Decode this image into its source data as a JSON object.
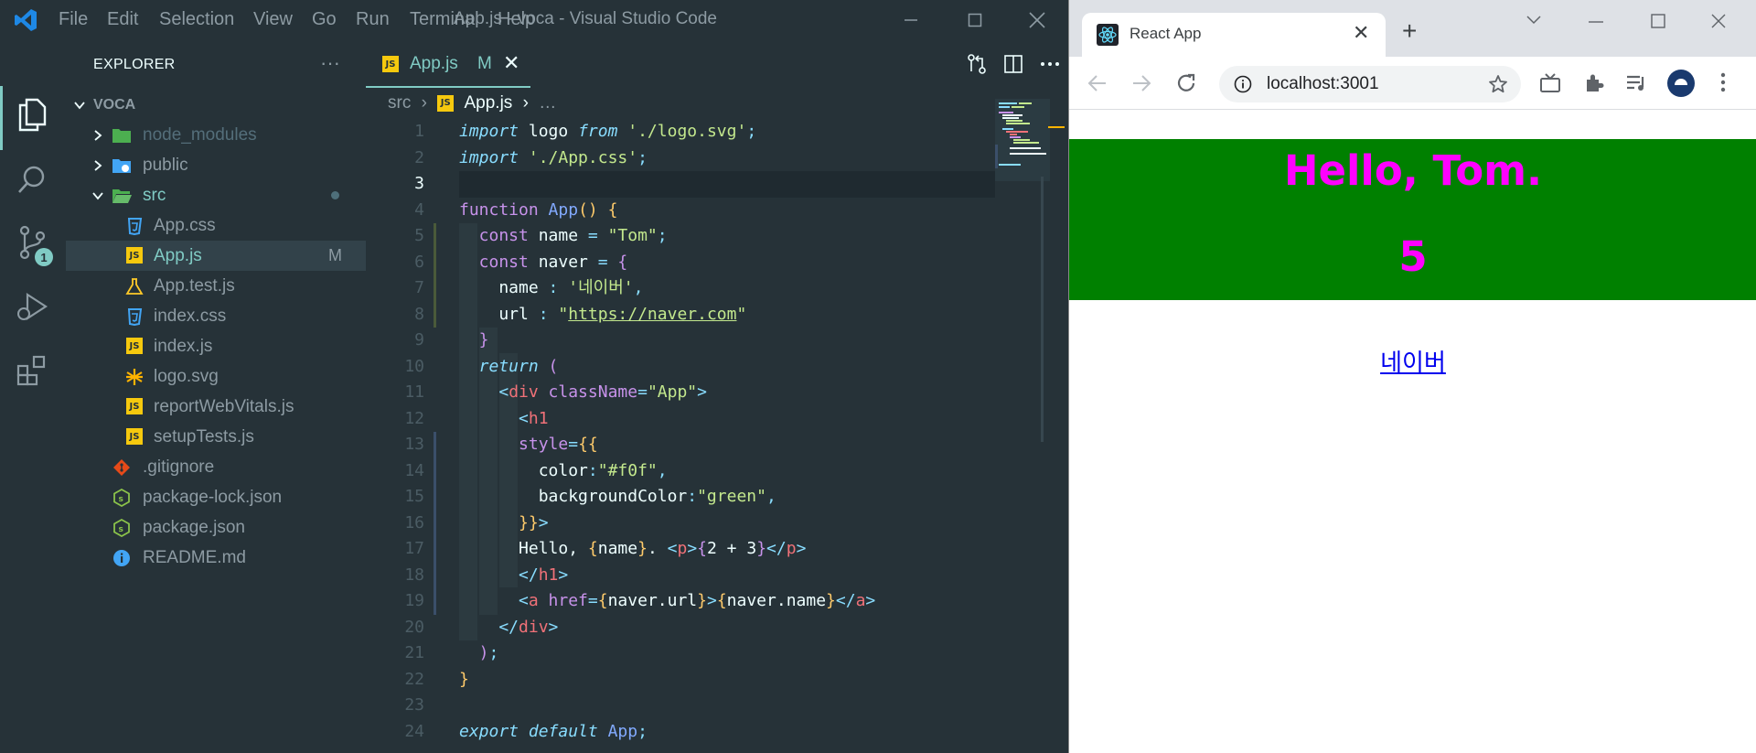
{
  "vscode": {
    "menu": [
      "File",
      "Edit",
      "Selection",
      "View",
      "Go",
      "Run",
      "Terminal",
      "Help"
    ],
    "window_title": "App.js - voca - Visual Studio Code",
    "scm_badge": "1",
    "explorer": {
      "header": "EXPLORER",
      "more": "···",
      "root": "VOCA",
      "items": [
        {
          "label": "node_modules",
          "type": "folder",
          "color": "#4caf50"
        },
        {
          "label": "public",
          "type": "folder",
          "color": "#42a5f5"
        },
        {
          "label": "src",
          "type": "folder-open",
          "color": "#4caf50"
        },
        {
          "label": "App.css",
          "type": "css"
        },
        {
          "label": "App.js",
          "type": "js",
          "git": "M"
        },
        {
          "label": "App.test.js",
          "type": "test"
        },
        {
          "label": "index.css",
          "type": "css"
        },
        {
          "label": "index.js",
          "type": "js"
        },
        {
          "label": "logo.svg",
          "type": "svg"
        },
        {
          "label": "reportWebVitals.js",
          "type": "js"
        },
        {
          "label": "setupTests.js",
          "type": "js"
        },
        {
          "label": ".gitignore",
          "type": "git"
        },
        {
          "label": "package-lock.json",
          "type": "npm"
        },
        {
          "label": "package.json",
          "type": "npm"
        },
        {
          "label": "README.md",
          "type": "info"
        }
      ]
    },
    "tab": {
      "label": "App.js",
      "status": "M",
      "close": "✕"
    },
    "breadcrumb": {
      "folder": "src",
      "file": "App.js",
      "more": "…"
    },
    "line_numbers": [
      "1",
      "2",
      "3",
      "4",
      "5",
      "6",
      "7",
      "8",
      "9",
      "10",
      "11",
      "12",
      "13",
      "14",
      "15",
      "16",
      "17",
      "18",
      "19",
      "20",
      "21",
      "22",
      "23",
      "24"
    ],
    "code": {
      "l1": {
        "a": "import",
        "b": " logo ",
        "c": "from",
        "d": " './logo.svg'",
        "e": ";"
      },
      "l2": {
        "a": "import",
        "b": " './App.css'",
        "c": ";"
      },
      "l4": {
        "a": "function ",
        "b": "App",
        "c": "() ",
        "d": "{"
      },
      "l5": {
        "a": "  const ",
        "b": "name ",
        "c": "= ",
        "d": "\"Tom\"",
        "e": ";"
      },
      "l6": {
        "a": "  const ",
        "b": "naver ",
        "c": "= ",
        "d": "{"
      },
      "l7": {
        "a": "    name ",
        "b": ": ",
        "c": "'네이버'",
        "d": ","
      },
      "l8": {
        "a": "    url ",
        "b": ": ",
        "c": "\"",
        "d": "https://naver.com",
        "e": "\""
      },
      "l9": {
        "a": "  }"
      },
      "l10": {
        "a": "  return ",
        "b": "("
      },
      "l11": {
        "a": "    <",
        "b": "div ",
        "c": "className",
        "d": "=",
        "e": "\"App\"",
        "f": ">"
      },
      "l12": {
        "a": "      <",
        "b": "h1"
      },
      "l13": {
        "a": "      style",
        "b": "=",
        "c": "{",
        "d": "{"
      },
      "l14": {
        "a": "        color",
        "b": ":",
        "c": "\"#f0f\"",
        "d": ","
      },
      "l15": {
        "a": "        backgroundColor",
        "b": ":",
        "c": "\"green\"",
        "d": ","
      },
      "l16": {
        "a": "      }",
        "b": "}",
        "c": ">"
      },
      "l17": {
        "a": "      Hello, ",
        "b": "{",
        "c": "name",
        "d": "}",
        "e": ". ",
        "f": "<",
        "g": "p",
        "h": ">",
        "i": "{",
        "j": "2 + 3",
        "k": "}",
        "l": "</",
        "m": "p",
        "n": ">"
      },
      "l18": {
        "a": "      </",
        "b": "h1",
        "c": ">"
      },
      "l19": {
        "a": "      <",
        "b": "a ",
        "c": "href",
        "d": "=",
        "e": "{",
        "f": "naver.url",
        "g": "}",
        "h": ">",
        "i": "{",
        "j": "naver.name",
        "k": "}",
        "l": "</",
        "m": "a",
        "n": ">"
      },
      "l20": {
        "a": "    </",
        "b": "div",
        "c": ">"
      },
      "l21": {
        "a": "  )",
        "b": ";"
      },
      "l22": {
        "a": "}"
      },
      "l24": {
        "a": "export default ",
        "b": "App",
        "c": ";"
      }
    }
  },
  "chrome": {
    "tab_title": "React App",
    "tab_close": "✕",
    "new_tab": "+",
    "url": "localhost:3001",
    "page": {
      "h1": "Hello, Tom.",
      "p": "5",
      "link": "네이버"
    }
  },
  "colors": {
    "editor_bg": "#263238",
    "accent": "#80cbc4",
    "h1_bg": "#008000",
    "h1_fg": "#ff00ff"
  }
}
